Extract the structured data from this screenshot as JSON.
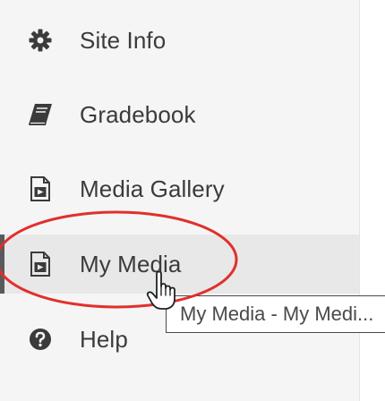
{
  "nav": {
    "items": [
      {
        "label": "Site Info",
        "icon": "gear-icon"
      },
      {
        "label": "Gradebook",
        "icon": "book-icon"
      },
      {
        "label": "Media Gallery",
        "icon": "media-file-icon"
      },
      {
        "label": "My Media",
        "icon": "media-file-icon",
        "active": true
      },
      {
        "label": "Help",
        "icon": "question-circle-icon"
      }
    ]
  },
  "tooltip": {
    "text": "My Media - My Medi..."
  },
  "colors": {
    "highlight_ring": "#e0302c",
    "text": "#3b3b3b",
    "active_bg": "#e8e8e8"
  }
}
